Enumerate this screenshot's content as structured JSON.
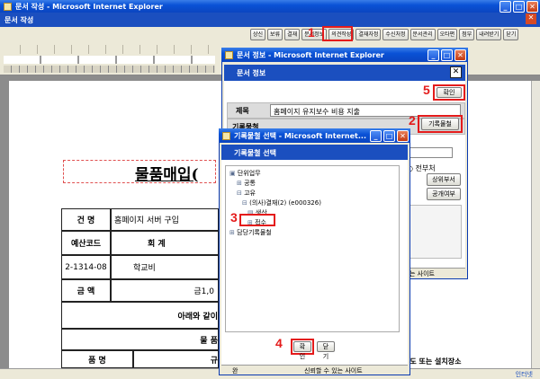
{
  "main_window": {
    "title": "문서 작성 - Microsoft Internet Explorer",
    "inner_title": "문서 작성",
    "status_right": "인터넷"
  },
  "toolbar_buttons": [
    "상신",
    "보류",
    "결재",
    "문서정보",
    "의견작성",
    "결재자정",
    "수신처정",
    "문서관리",
    "오타편",
    "첨부",
    "내려받기",
    "닫기"
  ],
  "document": {
    "heading": "물품매입(",
    "rows": {
      "r1_label": "건  명",
      "r1_value": "홈페이지 서버 구입",
      "r2_label": "예산코드",
      "r2_label2": "회  계",
      "r3_code": "2-1314-08",
      "r3_value": "학교비",
      "r4_label": "금  액",
      "r4_value": "금1,0",
      "r5_text": "아래와 같이",
      "r6_text": "물  품",
      "r7_label": "품  명",
      "r7_label2": "규"
    },
    "bottom_right": "용도 또는 설치장소"
  },
  "doc_info": {
    "title": "문서 정보 - Microsoft Internet Explorer",
    "inner_title": "문서 정보",
    "confirm": "확인",
    "subject_label": "제목",
    "subject_value": "홈페이지 유지보수 비용 지출",
    "record_label": "기록물철",
    "record_button": "기록물철",
    "dept_radio": "전부처",
    "upper_dept": "상위부서",
    "public": "공개여부",
    "status": "는 사이트"
  },
  "record_select": {
    "title": "기록물철 선택 - Microsoft Internet...",
    "inner_title": "기록물철 선택",
    "tree": [
      "단위업무",
      "공통",
      "고유",
      "(의사)결재(2) (e000326)",
      "생산",
      "접수",
      "담당기록물철"
    ],
    "confirm": "확인",
    "close": "닫기",
    "status_done": "완",
    "status_site": "신뢰할 수 있는 사이트"
  },
  "step_numbers": [
    "1",
    "2",
    "3",
    "4",
    "5"
  ]
}
